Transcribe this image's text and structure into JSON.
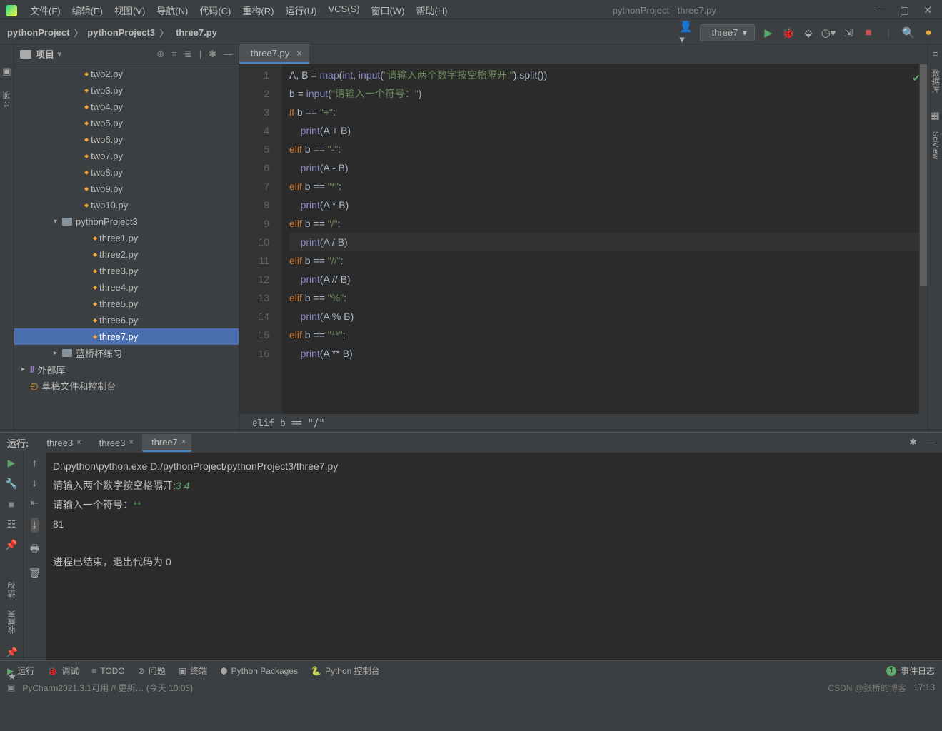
{
  "titlebar": {
    "menus": [
      "文件(F)",
      "编辑(E)",
      "视图(V)",
      "导航(N)",
      "代码(C)",
      "重构(R)",
      "运行(U)",
      "VCS(S)",
      "窗口(W)",
      "帮助(H)"
    ],
    "window_title": "pythonProject - three7.py"
  },
  "breadcrumb": {
    "items": [
      "pythonProject",
      "pythonProject3",
      "three7.py"
    ]
  },
  "run_config": {
    "label": "three7"
  },
  "sidebar": {
    "title": "项目",
    "tree": {
      "file_items_l1": [
        "two2.py",
        "two3.py",
        "two4.py",
        "two5.py",
        "two6.py",
        "two7.py",
        "two8.py",
        "two9.py",
        "two10.py"
      ],
      "folder_project3": "pythonProject3",
      "file_items_l2": [
        "three1.py",
        "three2.py",
        "three3.py",
        "three4.py",
        "three5.py",
        "three6.py",
        "three7.py"
      ],
      "selected": "three7.py",
      "folder_lanqiao": "蓝桥杯练习",
      "external_lib": "外部库",
      "scratch": "草稿文件和控制台"
    }
  },
  "editor": {
    "tab": "three7.py",
    "lines": [
      {
        "n": 1,
        "html": "A<span class='op'>,</span> B <span class='op'>=</span> <span class='builtin'>map</span>(<span class='builtin'>int</span><span class='op'>,</span> <span class='builtin'>input</span>(<span class='str'>\"请输入两个数字按空格隔开:\"</span>).split())"
      },
      {
        "n": 2,
        "html": "b <span class='op'>=</span> <span class='builtin'>input</span>(<span class='str'>\"请输入一个符号：\"</span>)"
      },
      {
        "n": 3,
        "html": "<span class='kw'>if</span> b <span class='op'>==</span> <span class='str'>\"+\"</span>:"
      },
      {
        "n": 4,
        "html": "    <span class='builtin'>print</span>(A <span class='op'>+</span> B)"
      },
      {
        "n": 5,
        "html": "<span class='kw'>elif</span> b <span class='op'>==</span> <span class='str'>\"-\"</span>:"
      },
      {
        "n": 6,
        "html": "    <span class='builtin'>print</span>(A <span class='op'>-</span> B)"
      },
      {
        "n": 7,
        "html": "<span class='kw'>elif</span> b <span class='op'>==</span> <span class='str'>\"*\"</span>:"
      },
      {
        "n": 8,
        "html": "    <span class='builtin'>print</span>(A <span class='op'>*</span> B)"
      },
      {
        "n": 9,
        "html": "<span class='kw'>elif</span> b <span class='op'>==</span> <span class='str'>\"/\"</span>:"
      },
      {
        "n": 10,
        "html": "    <span class='builtin'>print</span>(A <span class='op'>/</span> B)",
        "current": true
      },
      {
        "n": 11,
        "html": "<span class='kw'>elif</span> b <span class='op'>==</span> <span class='str'>\"//\"</span>:"
      },
      {
        "n": 12,
        "html": "    <span class='builtin'>print</span>(A <span class='op'>//</span> B)"
      },
      {
        "n": 13,
        "html": "<span class='kw'>elif</span> b <span class='op'>==</span> <span class='str'>\"%\"</span>:"
      },
      {
        "n": 14,
        "html": "    <span class='builtin'>print</span>(A <span class='op'>%</span> B)"
      },
      {
        "n": 15,
        "html": "<span class='kw'>elif</span> b <span class='op'>==</span> <span class='str'>\"**\"</span>:"
      },
      {
        "n": 16,
        "html": "    <span class='builtin'>print</span>(A <span class='op'>**</span> B)"
      }
    ],
    "status": "elif b == \"/\""
  },
  "run_panel": {
    "label": "运行:",
    "tabs": [
      {
        "name": "three3",
        "active": false
      },
      {
        "name": "three3",
        "active": false
      },
      {
        "name": "three7",
        "active": true
      }
    ],
    "console": {
      "cmd": "D:\\python\\python.exe D:/pythonProject/pythonProject3/three7.py",
      "prompt1": "请输入两个数字按空格隔开:",
      "input1": "3 4",
      "prompt2": "请输入一个符号：",
      "input2": "**",
      "result": "81",
      "exit": "进程已结束，退出代码为 0"
    }
  },
  "right_gutter": {
    "label1": "数据库",
    "label2": "SciView"
  },
  "left_gutter_bottom": {
    "items": [
      "结构",
      "收藏夹"
    ]
  },
  "status_bar": {
    "run": "运行",
    "debug": "调试",
    "todo": "TODO",
    "problems": "问题",
    "terminal": "终端",
    "py_packages": "Python Packages",
    "py_console": "Python 控制台",
    "event_log": "事件日志",
    "event_count": "1"
  },
  "footer": {
    "status": "PyCharm2021.3.1可用 // 更新… (今天 10:05)",
    "watermark": "CSDN @张桥的博客",
    "time": "17:13"
  }
}
